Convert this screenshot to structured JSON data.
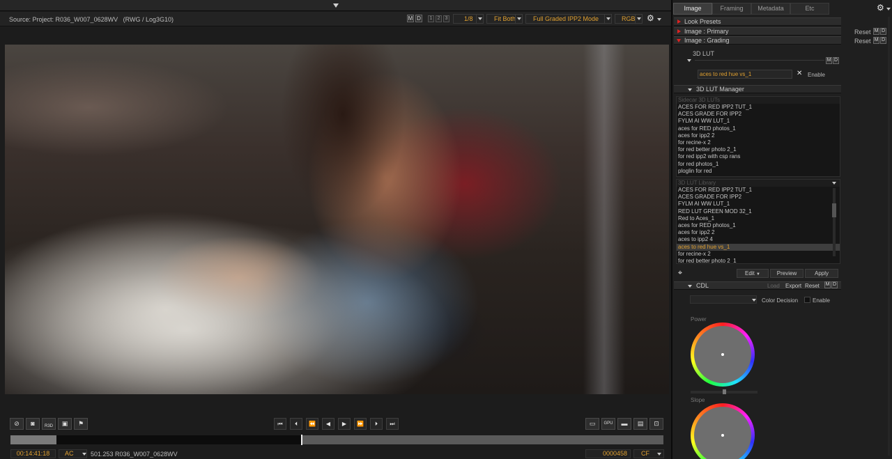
{
  "viewer": {
    "source_label": "Source: Project: R036_W007_0628WV",
    "source_space": "(RWG / Log3G10)",
    "m": "M",
    "d": "D",
    "nums": [
      "1",
      "2",
      "3"
    ],
    "zoom": "1/8",
    "fit": "Fit Both",
    "mode": "Full Graded IPP2 Mode",
    "channel": "RGB"
  },
  "transport": {
    "left_buttons": [
      "film-off",
      "camera",
      "R3D",
      "screen",
      "flag"
    ],
    "r3d_label": "R3D",
    "center_buttons": [
      "go-start",
      "prev-frame-step",
      "rewind",
      "play-reverse",
      "play",
      "fast-forward",
      "next-frame-step",
      "go-end"
    ],
    "right_buttons": [
      "monitor",
      "GPU",
      "display-a",
      "display-b",
      "display-c"
    ],
    "gpu_label": "GPU"
  },
  "status": {
    "timecode": "00:14:41:18",
    "tc_mode": "AC",
    "clip": "501.253 R036_W007_0628WV",
    "frame": "0000458",
    "frame_mode": "CF"
  },
  "panel": {
    "tabs": [
      "Image",
      "Framing",
      "Metadata",
      "Etc"
    ],
    "active_tab": "Image",
    "sections": {
      "look_presets": "Look Presets",
      "primary": "Image : Primary",
      "grading": "Image : Grading",
      "reset": "Reset"
    },
    "lut": {
      "label": "3D LUT",
      "value": "aces to red hue vs_1",
      "enable": "Enable"
    },
    "manager": {
      "title": "3D LUT Manager",
      "sidecar_header": "Sidecar 3D LUTs",
      "sidecar_items": [
        "ACES FOR RED IPP2 TUT_1",
        "ACES GRADE FOR IPP2",
        "FYLM AI WW LUT_1",
        "aces for RED photos_1",
        "aces for ipp2 2",
        "for recine-x 2",
        "for red better photo 2_1",
        "for red ipp2 with csp rans",
        "for red photos_1",
        "ploglin for red"
      ],
      "library_header": "3D LUT Library",
      "library_items": [
        "ACES FOR RED IPP2 TUT_1",
        "ACES GRADE FOR IPP2",
        "FYLM AI WW LUT_1",
        "RED LUT GREEN MOD 32_1",
        "Red to Aces_1",
        "aces for RED photos_1",
        "aces for ipp2 2",
        "aces to ipp2 4",
        "aces to red hue vs_1",
        "for recine-x 2",
        "for red better photo 2_1"
      ],
      "selected": "aces to red hue vs_1",
      "edit": "Edit",
      "preview": "Preview",
      "apply": "Apply"
    },
    "cdl": {
      "title": "CDL",
      "load": "Load",
      "export": "Export",
      "reset": "Reset",
      "decision": "Color Decision",
      "enable": "Enable",
      "power": "Power",
      "slope": "Slope"
    }
  }
}
